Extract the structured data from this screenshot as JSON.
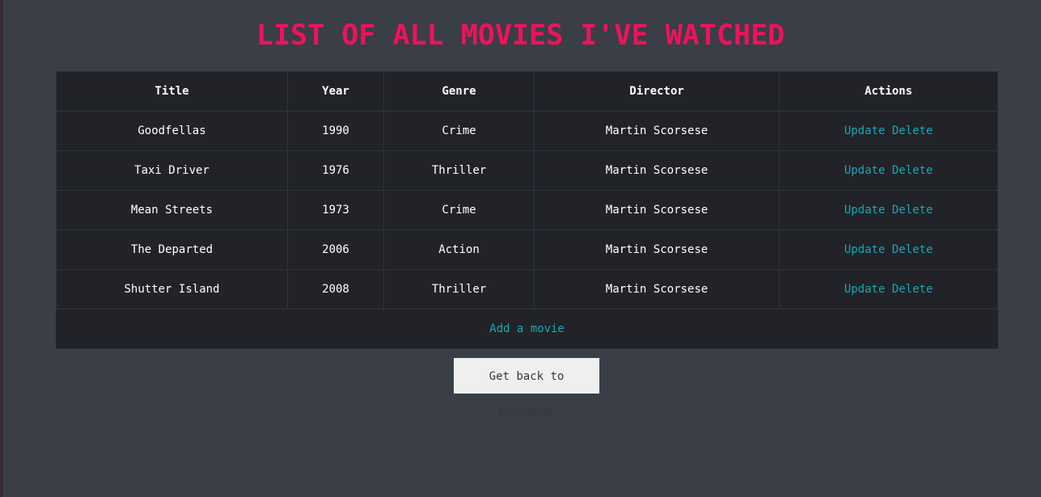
{
  "page_title": "LIST OF ALL MOVIES I'VE WATCHED",
  "table": {
    "headers": {
      "title": "Title",
      "year": "Year",
      "genre": "Genre",
      "director": "Director",
      "actions": "Actions"
    },
    "rows": [
      {
        "title": "Goodfellas",
        "year": "1990",
        "genre": "Crime",
        "director": "Martin Scorsese",
        "update": "Update",
        "delete": "Delete"
      },
      {
        "title": "Taxi Driver",
        "year": "1976",
        "genre": "Thriller",
        "director": "Martin Scorsese",
        "update": "Update",
        "delete": "Delete"
      },
      {
        "title": "Mean Streets",
        "year": "1973",
        "genre": "Crime",
        "director": "Martin Scorsese",
        "update": "Update",
        "delete": "Delete"
      },
      {
        "title": "The Departed",
        "year": "2006",
        "genre": "Action",
        "director": "Martin Scorsese",
        "update": "Update",
        "delete": "Delete"
      },
      {
        "title": "Shutter Island",
        "year": "2008",
        "genre": "Thriller",
        "director": "Martin Scorsese",
        "update": "Update",
        "delete": "Delete"
      }
    ],
    "add_label": "Add a movie"
  },
  "home_button_label": "Get back to homepage",
  "colors": {
    "title": "#f0125a",
    "link": "#1aa7b5",
    "background": "#3a3e47",
    "table_bg": "#212328"
  }
}
